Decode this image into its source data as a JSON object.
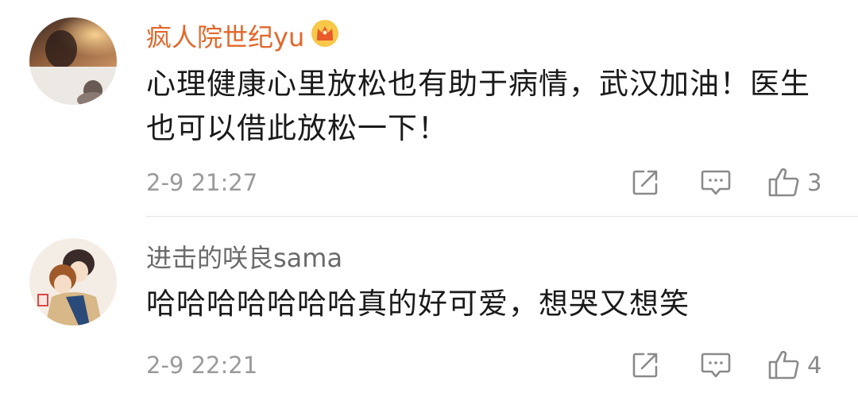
{
  "comments": [
    {
      "username": "疯人院世纪yu",
      "username_color": "#e2672a",
      "has_vip_badge": true,
      "badge_icon": "crown-badge-icon",
      "content": "心理健康心里放松也有助于病情，武汉加油！医生也可以借此放松一下！",
      "timestamp": "2-9 21:27",
      "likes": "3",
      "actions": [
        "share-icon",
        "reply-icon",
        "like-icon"
      ]
    },
    {
      "username": "进击的咲良sama",
      "username_color": "#6a6a6a",
      "has_vip_badge": false,
      "content": "哈哈哈哈哈哈哈真的好可爱，想哭又想笑",
      "timestamp": "2-9 22:21",
      "likes": "4",
      "actions": [
        "share-icon",
        "reply-icon",
        "like-icon"
      ]
    }
  ],
  "colors": {
    "meta_text": "#9a9a9a",
    "icon_stroke": "#8a8a8a",
    "divider": "#e3e3e3",
    "content_text": "#1a1a1a"
  }
}
